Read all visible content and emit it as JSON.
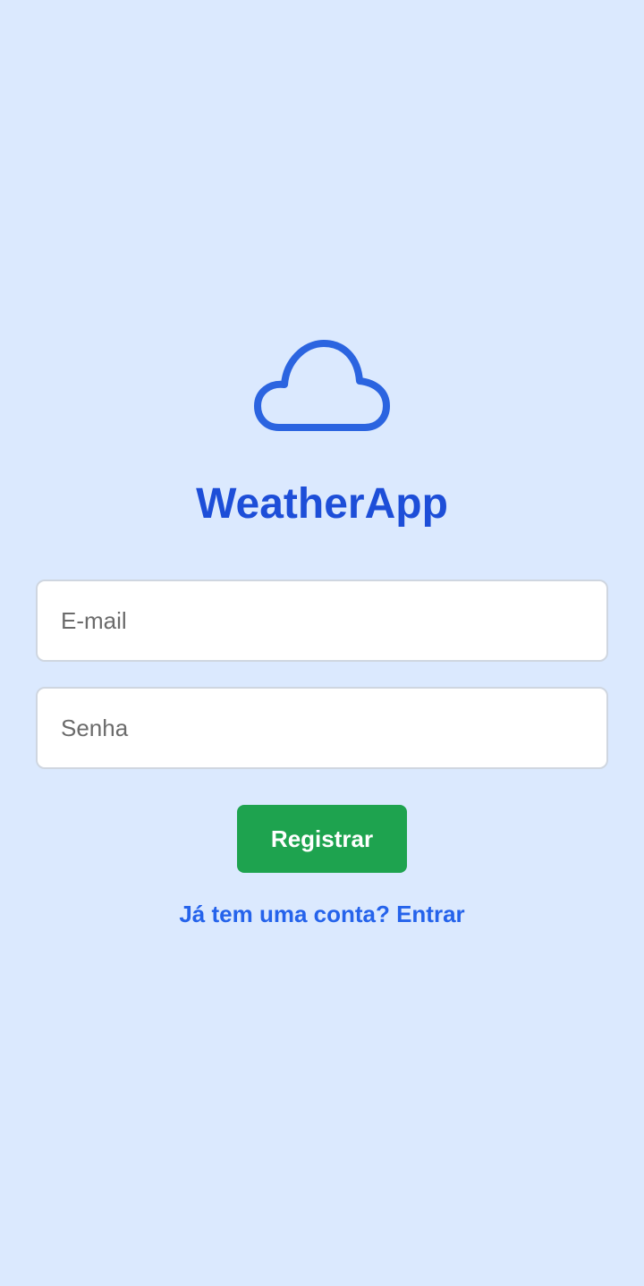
{
  "app": {
    "title": "WeatherApp",
    "logo_icon": "cloud-icon",
    "accent_color": "#2563eb",
    "background_color": "#dbe9fe"
  },
  "form": {
    "email": {
      "value": "",
      "placeholder": "E-mail"
    },
    "password": {
      "value": "",
      "placeholder": "Senha"
    },
    "register_label": "Registrar",
    "register_color": "#1ea34f"
  },
  "footer": {
    "login_link": "Já tem uma conta? Entrar"
  }
}
